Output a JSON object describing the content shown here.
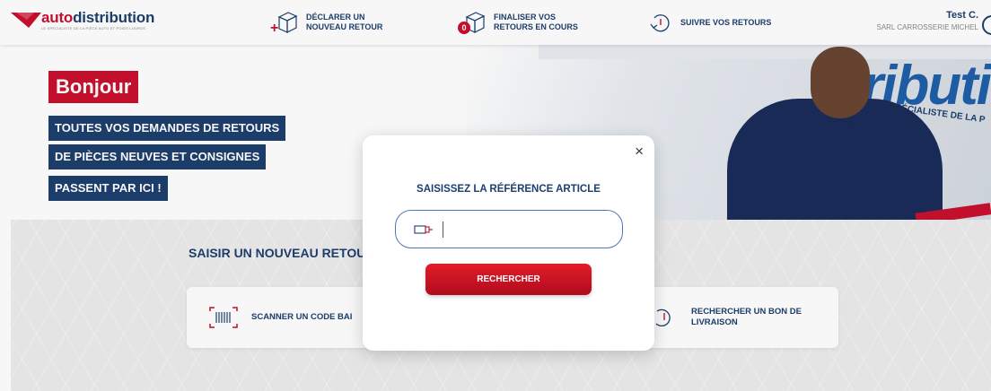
{
  "header": {
    "logo": {
      "word_auto": "auto",
      "word_rest": "distribution",
      "tagline": "LE SPÉCIALISTE DE LA PIÈCE AUTO ET POIDS LOURDS"
    },
    "nav": [
      {
        "label_line1": "DÉCLARER UN",
        "label_line2": "NOUVEAU RETOUR",
        "icon": "box-plus-icon"
      },
      {
        "label_line1": "FINALISER VOS",
        "label_line2": "RETOURS EN COURS",
        "icon": "box-badge-icon",
        "badge": "0"
      },
      {
        "label_line1": "SUIVRE VOS RETOURS",
        "label_line2": "",
        "icon": "return-arrow-icon"
      }
    ],
    "user": {
      "name": "Test C.",
      "company": "SARL CARROSSERIE MICHEL"
    }
  },
  "hero": {
    "greeting": "Bonjour",
    "lines": [
      "TOUTES VOS DEMANDES DE RETOURS",
      "DE PIÈCES NEUVES ET CONSIGNES",
      "PASSENT PAR ICI !"
    ],
    "truck_text": "ributi",
    "truck_subtext": "LE SPÉCIALISTE DE LA P"
  },
  "main": {
    "section_title": "SAISIR UN NOUVEAU RETOU",
    "cards": [
      {
        "label": "SCANNER UN CODE BAI",
        "icon": "barcode-icon"
      },
      {
        "label_line1": "RECHERCHER UN BON DE",
        "label_line2": "LIVRAISON",
        "icon": "return-arrow-icon"
      }
    ]
  },
  "modal": {
    "title": "SAISISSEZ LA RÉFÉRENCE ARTICLE",
    "close": "×",
    "input_value": "",
    "button_label": "RECHERCHER"
  },
  "colors": {
    "brand_red": "#c8102e",
    "brand_navy": "#1d3f6e",
    "input_border": "#4a7ab2"
  }
}
